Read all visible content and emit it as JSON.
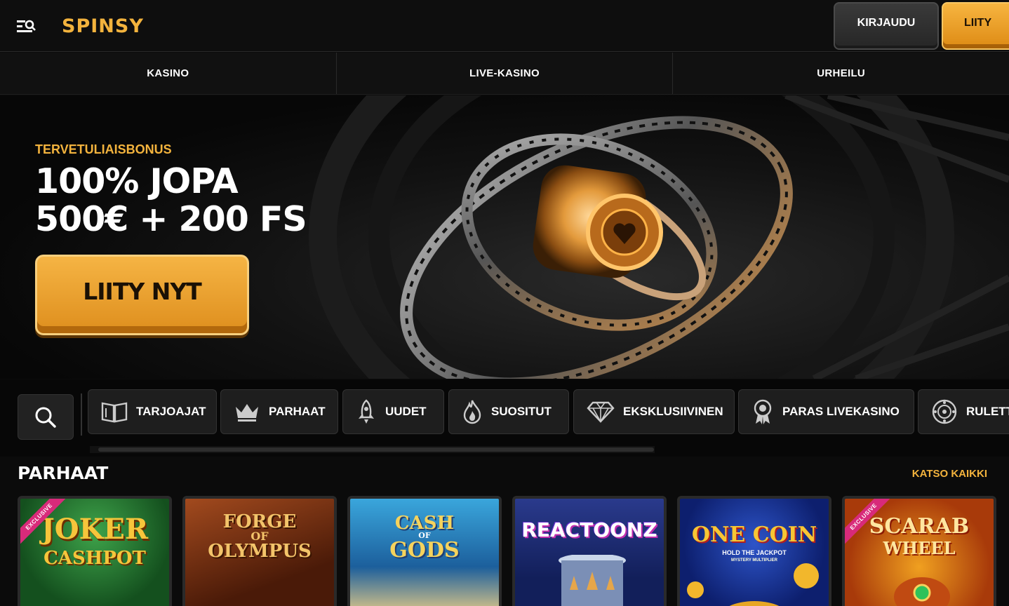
{
  "header": {
    "logo": "SPINSY",
    "login_label": "KIRJAUDU",
    "join_label": "LIITY"
  },
  "nav": {
    "items": [
      {
        "label": "KASINO"
      },
      {
        "label": "LIVE-KASINO"
      },
      {
        "label": "URHEILU"
      }
    ]
  },
  "hero": {
    "eyebrow": "TERVETULIAISBONUS",
    "title_line1": "100% JOPA",
    "title_line2": "500€ + 200 FS",
    "cta_label": "LIITY NYT"
  },
  "filters": {
    "items": [
      {
        "label": "TARJOAJAT",
        "icon": "book-icon"
      },
      {
        "label": "PARHAAT",
        "icon": "crown-icon"
      },
      {
        "label": "UUDET",
        "icon": "rocket-icon"
      },
      {
        "label": "SUOSITUT",
        "icon": "flame-icon"
      },
      {
        "label": "EKSKLUSIIVINEN",
        "icon": "diamond-icon"
      },
      {
        "label": "PARAS LIVEKASINO",
        "icon": "award-icon"
      },
      {
        "label": "RULETTI",
        "icon": "roulette-icon"
      }
    ]
  },
  "section": {
    "title": "PARHAAT",
    "see_all": "KATSO KAIKKI"
  },
  "games": [
    {
      "line1": "JOKER",
      "line2": "CASHPOT",
      "ribbon": "EXCLUSIVE"
    },
    {
      "line1": "FORGE",
      "line2": "OF",
      "line3": "OLYMPUS"
    },
    {
      "line1": "CASH",
      "line2": "OF",
      "line3": "GODS"
    },
    {
      "line1": "REACTOONZ"
    },
    {
      "line1": "ONE COIN",
      "line2": "HOLD THE JACKPOT",
      "line3": "MYSTERY MULTIPLIER"
    },
    {
      "line1": "SCARAB",
      "line2": "WHEEL",
      "ribbon": "EXCLUSIVE"
    }
  ],
  "colors": {
    "accent": "#f3b33d",
    "background": "#0b0b0b",
    "exclusive_ribbon": "#d82a7a"
  }
}
